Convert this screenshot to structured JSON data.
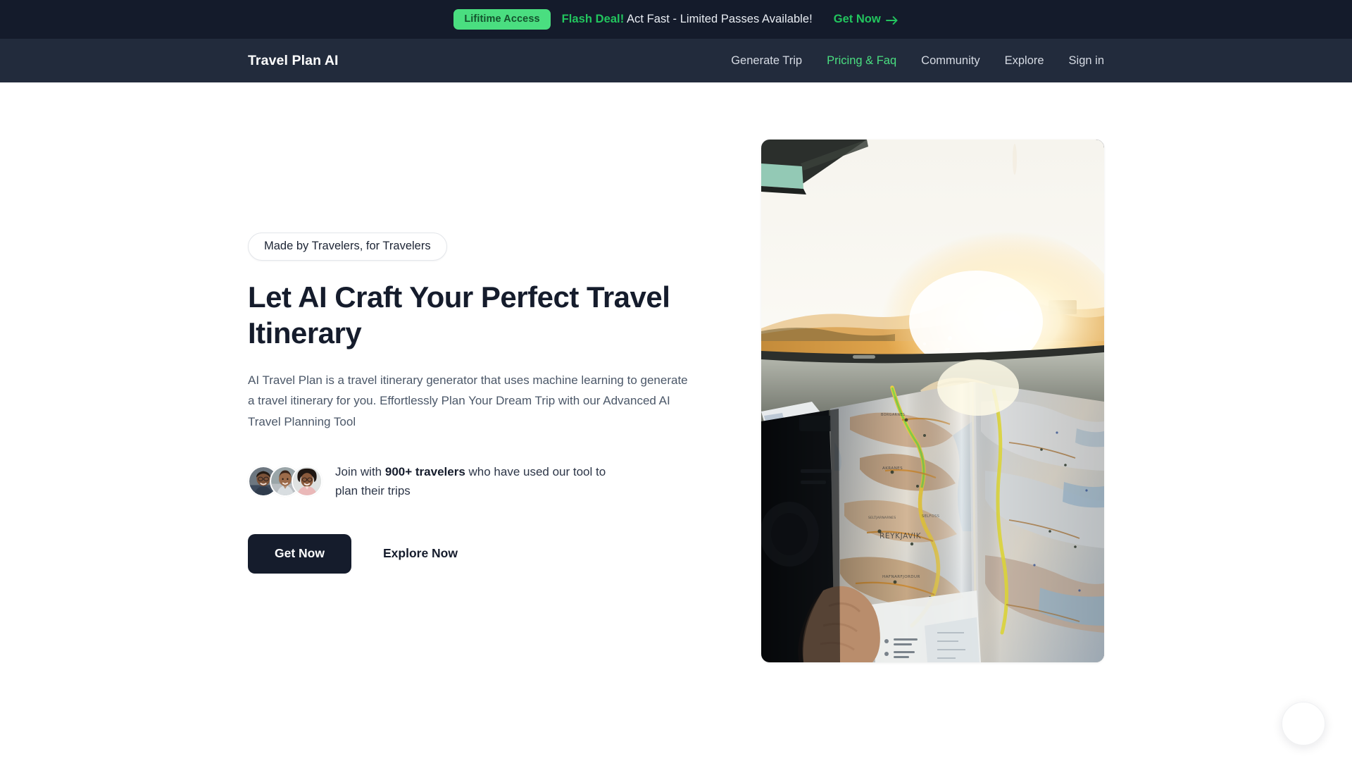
{
  "promo": {
    "pill_label": "Lifitime Access",
    "flash_label": "Flash Deal!",
    "message": "Act Fast - Limited Passes Available!",
    "cta_label": "Get Now",
    "cta_icon": "arrow-right-icon",
    "background_color": "#141b2b",
    "pill_color": "#4ade80",
    "accent_color": "#22c55e"
  },
  "navbar": {
    "brand": "Travel Plan AI",
    "background_color": "#222b3c",
    "active_color": "#4ade80",
    "links": [
      {
        "label": "Generate Trip",
        "active": false
      },
      {
        "label": "Pricing & Faq",
        "active": true
      },
      {
        "label": "Community",
        "active": false
      },
      {
        "label": "Explore",
        "active": false
      },
      {
        "label": "Sign in",
        "active": false
      }
    ]
  },
  "hero": {
    "badge": "Made by Travelers, for Travelers",
    "title": "Let AI Craft Your Perfect Travel Itinerary",
    "description": "AI Travel Plan is a travel itinerary generator that uses machine learning to generate a travel itinerary for you. Effortlessly Plan Your Dream Trip with our Advanced AI Travel Planning Tool",
    "social_proof": {
      "prefix": "Join with ",
      "highlight": "900+ travelers",
      "suffix": " who have used our tool to plan their trips",
      "avatar_count": 3
    },
    "primary_cta": "Get Now",
    "secondary_cta": "Explore Now",
    "image_alt": "Road trip sunset view through car windshield with a folded Iceland road map showing Reykjavik",
    "title_color": "#151c2c",
    "description_color": "#4b5768"
  },
  "floating": {
    "chat_button_label": "chat-widget-button"
  }
}
